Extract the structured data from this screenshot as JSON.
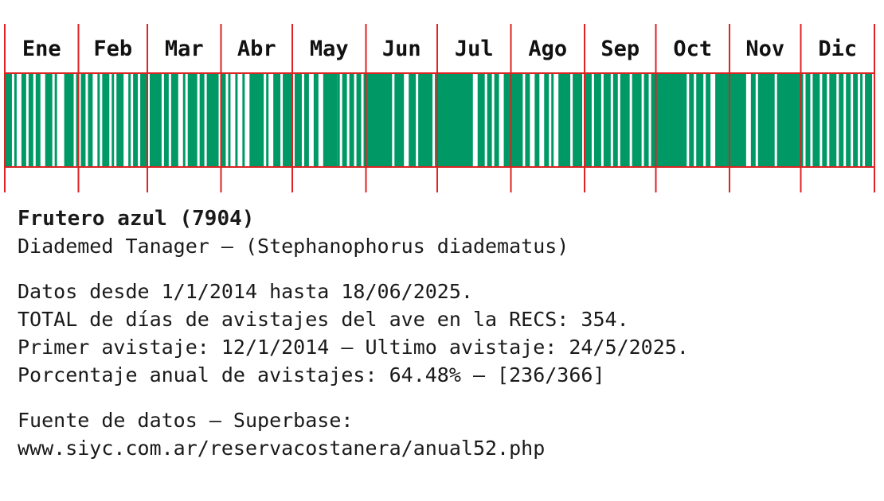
{
  "colors": {
    "presence": "#009966",
    "grid": "#dd2222",
    "background": "#ffffff",
    "text": "#1a1a1a"
  },
  "chart_data": {
    "type": "bar",
    "title": "",
    "xlabel": "",
    "ylabel": "",
    "months": [
      "Ene",
      "Feb",
      "Mar",
      "Abr",
      "May",
      "Jun",
      "Jul",
      "Ago",
      "Sep",
      "Oct",
      "Nov",
      "Dic"
    ],
    "days_in_year": 366,
    "presence_runs_description": "day-of-year ranges [start_day, end_day] (1-366) with at least one sighting",
    "presence_runs": [
      [
        1,
        3
      ],
      [
        5,
        5
      ],
      [
        8,
        9
      ],
      [
        11,
        12
      ],
      [
        14,
        15
      ],
      [
        18,
        20
      ],
      [
        22,
        22
      ],
      [
        26,
        29
      ],
      [
        31,
        31
      ],
      [
        33,
        34
      ],
      [
        36,
        37
      ],
      [
        40,
        40
      ],
      [
        42,
        44
      ],
      [
        46,
        46
      ],
      [
        48,
        50
      ],
      [
        53,
        53
      ],
      [
        55,
        56
      ],
      [
        58,
        60
      ],
      [
        62,
        66
      ],
      [
        68,
        69
      ],
      [
        71,
        73
      ],
      [
        76,
        76
      ],
      [
        78,
        81
      ],
      [
        83,
        84
      ],
      [
        86,
        90
      ],
      [
        92,
        93
      ],
      [
        95,
        95
      ],
      [
        98,
        98
      ],
      [
        101,
        101
      ],
      [
        104,
        109
      ],
      [
        111,
        111
      ],
      [
        114,
        116
      ],
      [
        118,
        121
      ],
      [
        123,
        125
      ],
      [
        127,
        128
      ],
      [
        131,
        132
      ],
      [
        135,
        140
      ],
      [
        141,
        141
      ],
      [
        143,
        144
      ],
      [
        146,
        147
      ],
      [
        149,
        150
      ],
      [
        152,
        163
      ],
      [
        165,
        168
      ],
      [
        171,
        173
      ],
      [
        175,
        180
      ],
      [
        182,
        197
      ],
      [
        200,
        202
      ],
      [
        204,
        205
      ],
      [
        207,
        208
      ],
      [
        211,
        212
      ],
      [
        213,
        218
      ],
      [
        220,
        221
      ],
      [
        224,
        225
      ],
      [
        228,
        229
      ],
      [
        231,
        231
      ],
      [
        234,
        238
      ],
      [
        240,
        243
      ],
      [
        245,
        247
      ],
      [
        249,
        251
      ],
      [
        253,
        255
      ],
      [
        257,
        258
      ],
      [
        260,
        263
      ],
      [
        265,
        268
      ],
      [
        270,
        271
      ],
      [
        273,
        274
      ],
      [
        274,
        287
      ],
      [
        289,
        290
      ],
      [
        292,
        294
      ],
      [
        296,
        297
      ],
      [
        300,
        303
      ],
      [
        304,
        312
      ],
      [
        315,
        316
      ],
      [
        318,
        324
      ],
      [
        326,
        334
      ],
      [
        335,
        336
      ],
      [
        338,
        339
      ],
      [
        341,
        343
      ],
      [
        345,
        346
      ],
      [
        348,
        350
      ],
      [
        352,
        353
      ],
      [
        355,
        356
      ],
      [
        358,
        359
      ],
      [
        361,
        361
      ],
      [
        363,
        365
      ]
    ]
  },
  "info": {
    "title": "Frutero azul (7904)",
    "subtitle": "Diademed Tanager – (Stephanophorus diadematus)",
    "range": "Datos desde 1/1/2014 hasta 18/06/2025.",
    "total": "TOTAL de días de avistajes del ave en la RECS: 354.",
    "first_last": "Primer avistaje: 12/1/2014 – Ultimo avistaje: 24/5/2025.",
    "percentage": "Porcentaje anual de avistajes: 64.48% – [236/366]",
    "source_label": "Fuente de datos – Superbase:",
    "source_url": "www.siyc.com.ar/reservacostanera/anual52.php"
  }
}
